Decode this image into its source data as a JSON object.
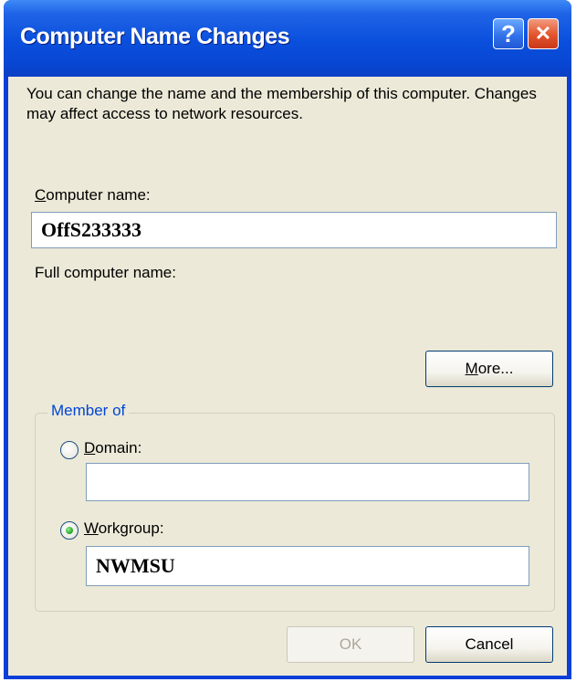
{
  "window": {
    "title": "Computer Name Changes",
    "help_glyph": "?",
    "close_glyph": "✕"
  },
  "description": "You can change the name and the membership of this computer. Changes may affect access to network resources.",
  "computer_name": {
    "label_accel": "C",
    "label_rest": "omputer name:",
    "value": "OffS233333"
  },
  "full_computer_name": {
    "label": "Full computer name:",
    "value": ""
  },
  "more_button": {
    "label_accel": "M",
    "label_rest": "ore..."
  },
  "member_of": {
    "legend": "Member of",
    "domain": {
      "label_accel": "D",
      "label_rest": "omain:",
      "selected": false,
      "value": ""
    },
    "workgroup": {
      "label_accel": "W",
      "label_rest": "orkgroup:",
      "selected": true,
      "value": "NWMSU"
    }
  },
  "buttons": {
    "ok": "OK",
    "cancel": "Cancel"
  },
  "colors": {
    "title_bar": "#0a4fdc",
    "client_bg": "#ece9d8",
    "group_legend": "#0046d5",
    "close_button": "#e2542c"
  }
}
